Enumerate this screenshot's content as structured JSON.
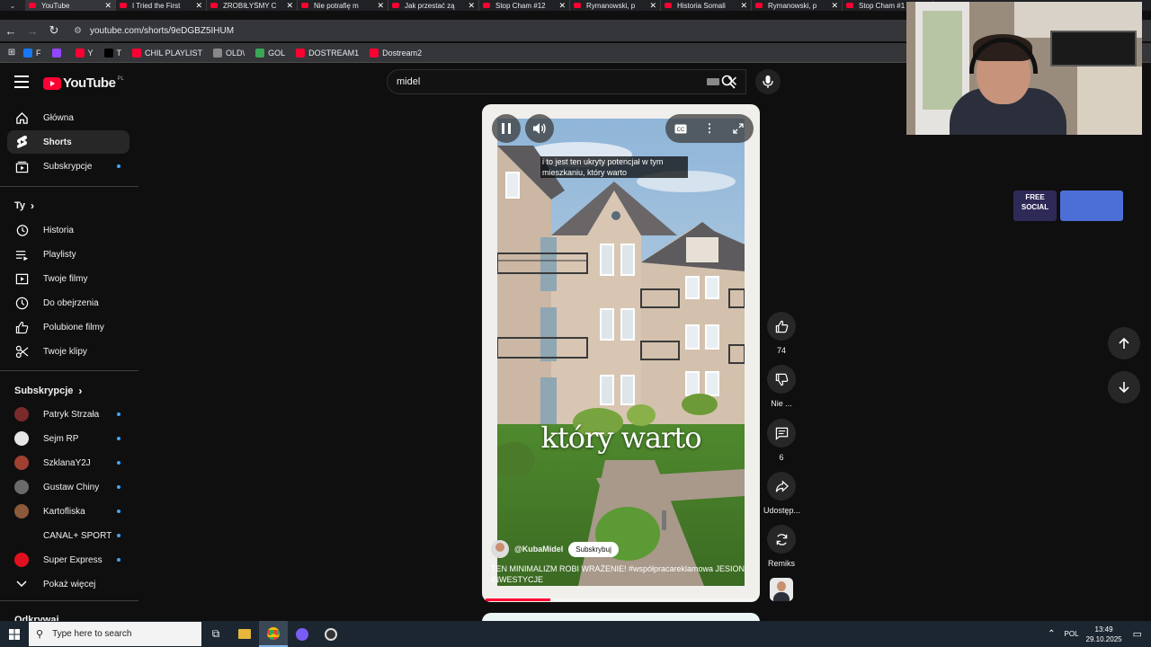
{
  "browser": {
    "tabs": [
      {
        "title": "YouTube",
        "active": true
      },
      {
        "title": "I Tried the First"
      },
      {
        "title": "ZROBIŁYŚMY C"
      },
      {
        "title": "Nie potrafię m"
      },
      {
        "title": "Jak przestać zą"
      },
      {
        "title": "Stop Cham #12"
      },
      {
        "title": "Rymanowski, p"
      },
      {
        "title": "Historia Somali"
      },
      {
        "title": "Rymanowski, p"
      },
      {
        "title": "Stop Cham #1"
      }
    ],
    "url": "youtube.com/shorts/9eDGBZ5IHUM",
    "bookmarks": [
      {
        "label": "F",
        "color": "#1877f2"
      },
      {
        "label": "",
        "color": "#9146ff"
      },
      {
        "label": "Y",
        "color": "#ff0033"
      },
      {
        "label": "T",
        "color": "#000000"
      },
      {
        "label": "CHIL PLAYLIST",
        "color": "#ff0033"
      },
      {
        "label": "OLD\\",
        "color": "#888888"
      },
      {
        "label": "GOL",
        "color": "#3aa757"
      },
      {
        "label": "DOSTREAM1",
        "color": "#ff0033"
      },
      {
        "label": "Dostream2",
        "color": "#ff0033"
      }
    ]
  },
  "youtube": {
    "logo_text": "YouTube",
    "logo_country": "PL",
    "search_value": "midel",
    "sidebar": {
      "main": [
        {
          "label": "Główna",
          "icon": "home-icon"
        },
        {
          "label": "Shorts",
          "icon": "shorts-icon",
          "active": true
        },
        {
          "label": "Subskrypcje",
          "icon": "subscriptions-icon",
          "dot": true
        }
      ],
      "you_header": "Ty",
      "you": [
        {
          "label": "Historia",
          "icon": "history-icon"
        },
        {
          "label": "Playlisty",
          "icon": "playlist-icon"
        },
        {
          "label": "Twoje filmy",
          "icon": "your-videos-icon"
        },
        {
          "label": "Do obejrzenia",
          "icon": "watch-later-icon"
        },
        {
          "label": "Polubione filmy",
          "icon": "liked-icon"
        },
        {
          "label": "Twoje klipy",
          "icon": "clips-icon"
        }
      ],
      "subs_header": "Subskrypcje",
      "subs": [
        {
          "label": "Patryk Strzała",
          "color": "#7a2a2a"
        },
        {
          "label": "Sejm RP",
          "color": "#e6e6e6"
        },
        {
          "label": "SzklanaY2J",
          "color": "#a04030"
        },
        {
          "label": "Gustaw Chiny",
          "color": "#6a6a6a"
        },
        {
          "label": "Kartofliska",
          "color": "#8a5a3a"
        },
        {
          "label": "CANAL+ SPORT",
          "color": "#101010"
        },
        {
          "label": "Super Express",
          "color": "#e01020"
        }
      ],
      "show_more": "Pokaż więcej",
      "cut_header": "Odkrywaj"
    },
    "short": {
      "caption": "i to jest ten ukryty potencjał w tym mieszkaniu, który warto",
      "overlay_text": "który warto",
      "channel": "@KubaMidel",
      "subscribe": "Subskrybuj",
      "description": "TEN MINIMALIZM ROBI WRAŻENIE! #współpracareklamowa JESION INWESTYCJE",
      "progress": 0.24
    },
    "actions": {
      "likes": "74",
      "dislike_label": "Nie ...",
      "comments": "6",
      "share_label": "Udostęp...",
      "remix_label": "Remiks"
    }
  },
  "overlay": {
    "sticker_text": "FREE SOCIAL"
  },
  "taskbar": {
    "search_placeholder": "Type here to search",
    "lang": "POL",
    "time": "13:49",
    "date": "29.10.2025"
  }
}
